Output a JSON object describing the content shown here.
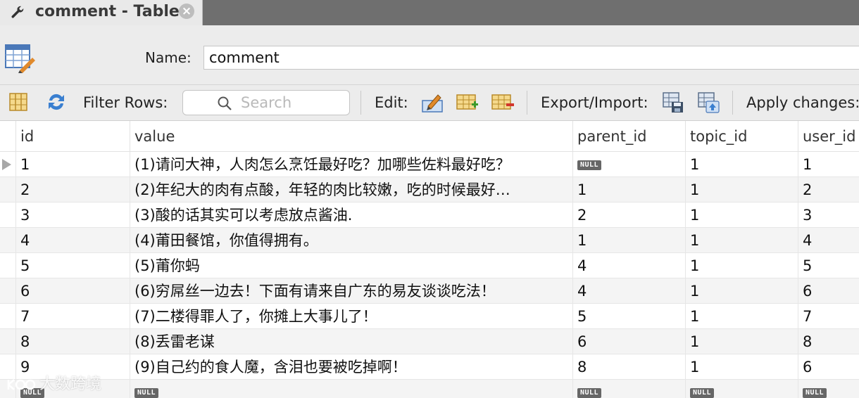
{
  "tab": {
    "title": "comment - Table",
    "close_glyph": "×",
    "icon": "wrench-icon"
  },
  "name_row": {
    "label": "Name:",
    "value": "comment",
    "icon": "table-edit-icon"
  },
  "toolbar": {
    "filter_label": "Filter Rows:",
    "search_placeholder": "Search",
    "edit_label": "Edit:",
    "export_label": "Export/Import:",
    "apply_label": "Apply changes:"
  },
  "grid": {
    "columns": [
      "id",
      "value",
      "parent_id",
      "topic_id",
      "user_id"
    ],
    "null_label": "NULL",
    "rows": [
      {
        "id": "1",
        "value": "(1)请问大神，人肉怎么烹饪最好吃？加哪些佐料最好吃？",
        "parent_id": "NULL",
        "topic_id": "1",
        "user_id": "1"
      },
      {
        "id": "2",
        "value": "(2)年纪大的肉有点酸，年轻的肉比较嫩，吃的时候最好…",
        "parent_id": "1",
        "topic_id": "1",
        "user_id": "2"
      },
      {
        "id": "3",
        "value": "(3)酸的话其实可以考虑放点酱油.",
        "parent_id": "2",
        "topic_id": "1",
        "user_id": "3"
      },
      {
        "id": "4",
        "value": "(4)莆田餐馆，你值得拥有。",
        "parent_id": "1",
        "topic_id": "1",
        "user_id": "4"
      },
      {
        "id": "5",
        "value": "(5)莆你蚂",
        "parent_id": "4",
        "topic_id": "1",
        "user_id": "5"
      },
      {
        "id": "6",
        "value": "(6)穷屌丝一边去！下面有请来自广东的易友谈谈吃法！",
        "parent_id": "4",
        "topic_id": "1",
        "user_id": "6"
      },
      {
        "id": "7",
        "value": "(7)二楼得罪人了，你摊上大事儿了！",
        "parent_id": "5",
        "topic_id": "1",
        "user_id": "7"
      },
      {
        "id": "8",
        "value": "(8)丢雷老谋",
        "parent_id": "6",
        "topic_id": "1",
        "user_id": "8"
      },
      {
        "id": "9",
        "value": "(9)自己约的食人魔，含泪也要被吃掉啊！",
        "parent_id": "8",
        "topic_id": "1",
        "user_id": "6"
      },
      {
        "id": "NULL",
        "value": "NULL",
        "parent_id": "NULL",
        "topic_id": "NULL",
        "user_id": "NULL"
      }
    ]
  },
  "watermark": {
    "text": "大数跨境"
  },
  "colors": {
    "tab_bar": "#6f6f6f",
    "toolbar_bg": "#ececec",
    "null_badge": "#666666"
  }
}
